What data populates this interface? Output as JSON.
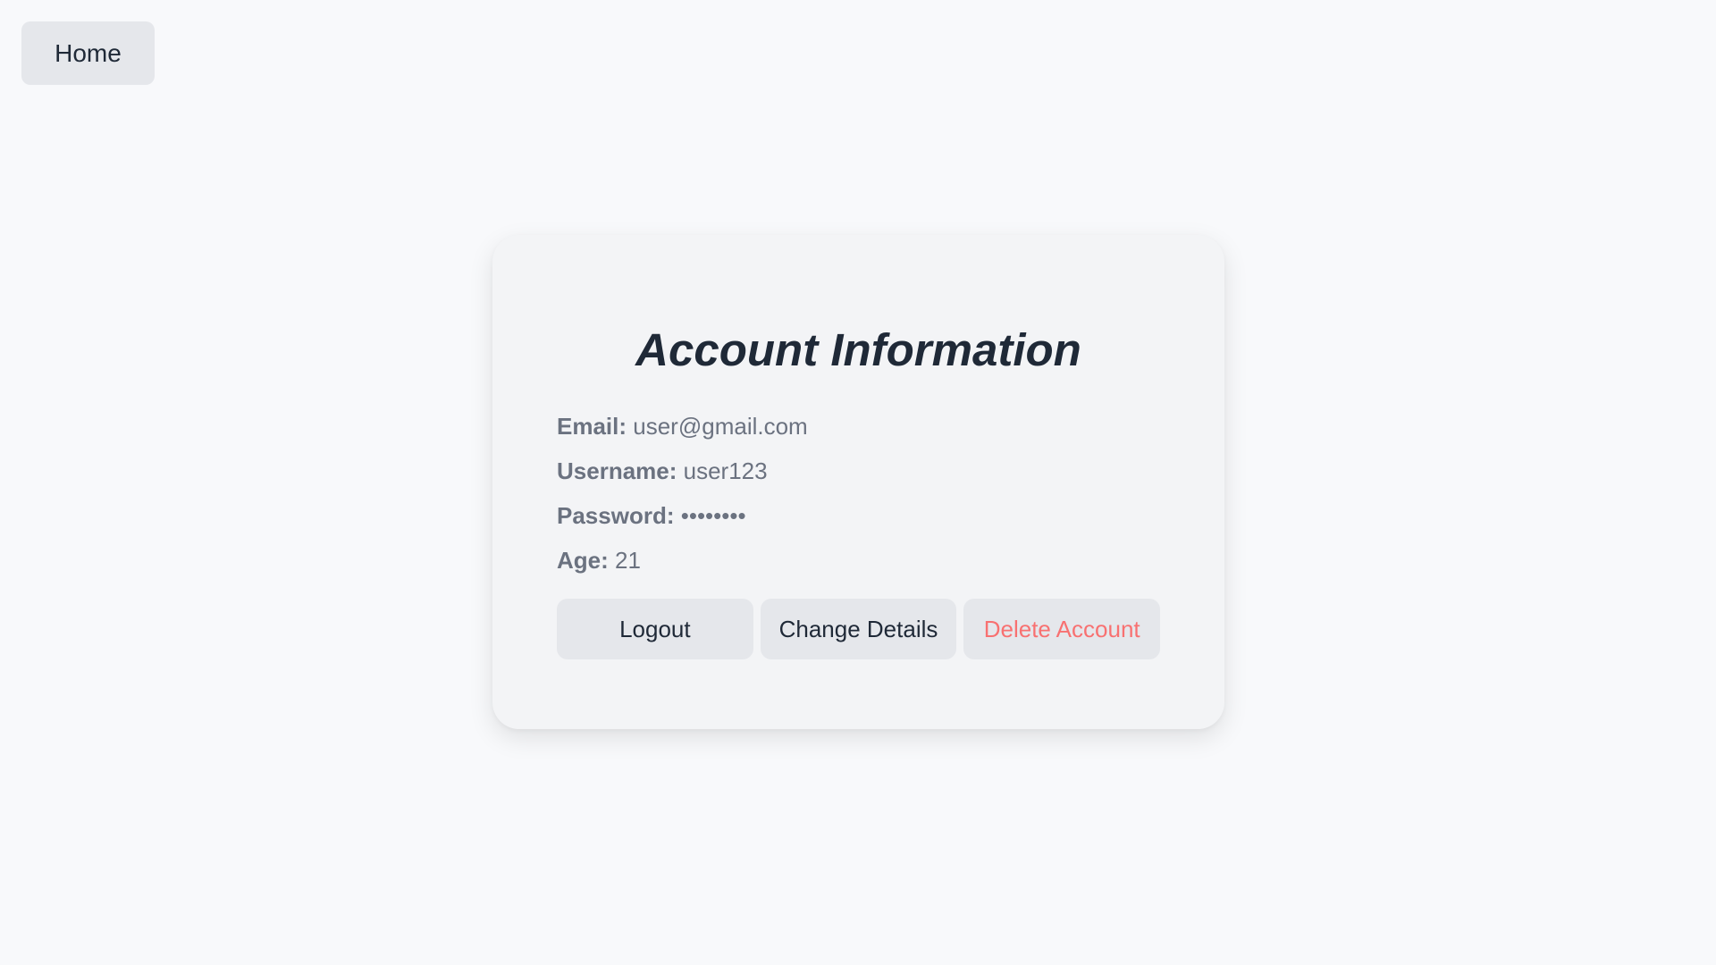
{
  "nav": {
    "home_label": "Home"
  },
  "card": {
    "title": "Account Information",
    "fields": [
      {
        "label": "Email:",
        "value": "user@gmail.com"
      },
      {
        "label": "Username:",
        "value": "user123"
      },
      {
        "label": "Password:",
        "value": "••••••••"
      },
      {
        "label": "Age:",
        "value": "21"
      }
    ],
    "actions": {
      "logout_label": "Logout",
      "change_details_label": "Change Details",
      "delete_account_label": "Delete Account"
    }
  },
  "colors": {
    "page_background": "#f8f9fb",
    "card_background": "#f3f4f6",
    "button_background": "#e5e7eb",
    "title_text": "#1f2937",
    "field_text": "#6b7280",
    "danger_text": "#f87171"
  }
}
